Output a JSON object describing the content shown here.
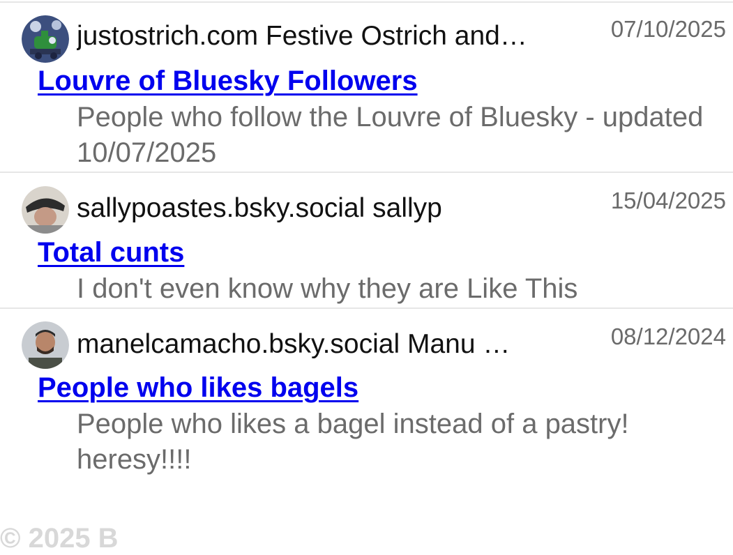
{
  "items": [
    {
      "author": "justostrich.com Festive Ostrich and…",
      "date": "07/10/2025",
      "title": "Louvre of Bluesky Followers",
      "description": "People who follow the Louvre of Bluesky - updated 10/07/2025",
      "avatar_icon": "ostrich-avatar"
    },
    {
      "author": "sallypoastes.bsky.social sallyp",
      "date": "15/04/2025",
      "title": "Total cunts",
      "description": "I don't even know why they are Like This",
      "avatar_icon": "person-cap-avatar"
    },
    {
      "author": "manelcamacho.bsky.social Manu …",
      "date": "08/12/2024",
      "title": "People who likes bagels",
      "description": "People who likes a bagel instead of a pastry! heresy!!!!",
      "avatar_icon": "person-avatar"
    }
  ],
  "footer": {
    "text": "© 2025 B"
  },
  "colors": {
    "link": "#0000ee",
    "muted_text": "#6b6b6b",
    "date_text": "#6a6a6a",
    "separator": "#e6e6e6"
  }
}
